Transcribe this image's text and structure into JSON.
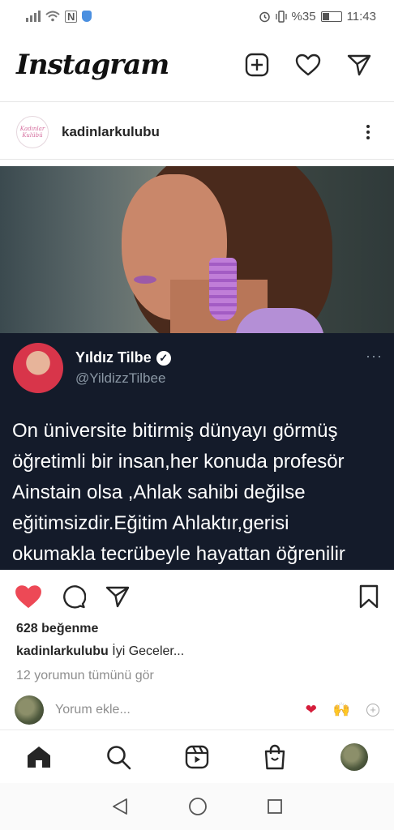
{
  "status_bar": {
    "battery_text": "%35",
    "time": "11:43",
    "nfc_label": "N"
  },
  "app": {
    "title": "Instagram"
  },
  "post": {
    "username": "kadinlarkulubu",
    "avatar_text": "Kadınlar Kulübü",
    "tweet": {
      "name": "Yıldız Tilbe",
      "handle": "@YildizzTilbee",
      "more": "···",
      "text": "On üniversite bitirmiş dünyayı görmüş\nöğretimli bir insan,her konuda profesör\nAinstain olsa ,Ahlak sahibi değilse\neğitimsizdir.Eğitim Ahlaktır,gerisi\nokumakla tecrübeyle hayattan öğrenilir"
    },
    "liked": true,
    "likes_text": "628 beğenme",
    "caption_user": "kadinlarkulubu",
    "caption_text": "İyi Geceler...",
    "comments_link": "12 yorumun tümünü gör",
    "comment_placeholder": "Yorum ekle...",
    "quick_emojis": [
      "❤",
      "🙌",
      "+"
    ]
  },
  "colors": {
    "like_red": "#ed4956",
    "tweet_bg": "#141b2a",
    "muted_text": "#8e8e8e"
  },
  "icons": {
    "header": [
      "new-post-icon",
      "heart-icon",
      "direct-message-icon"
    ],
    "bottom_nav": [
      "home-icon",
      "search-icon",
      "reels-icon",
      "shop-icon",
      "profile-avatar"
    ],
    "system_nav": [
      "back-icon",
      "home-circle-icon",
      "recents-icon"
    ]
  }
}
